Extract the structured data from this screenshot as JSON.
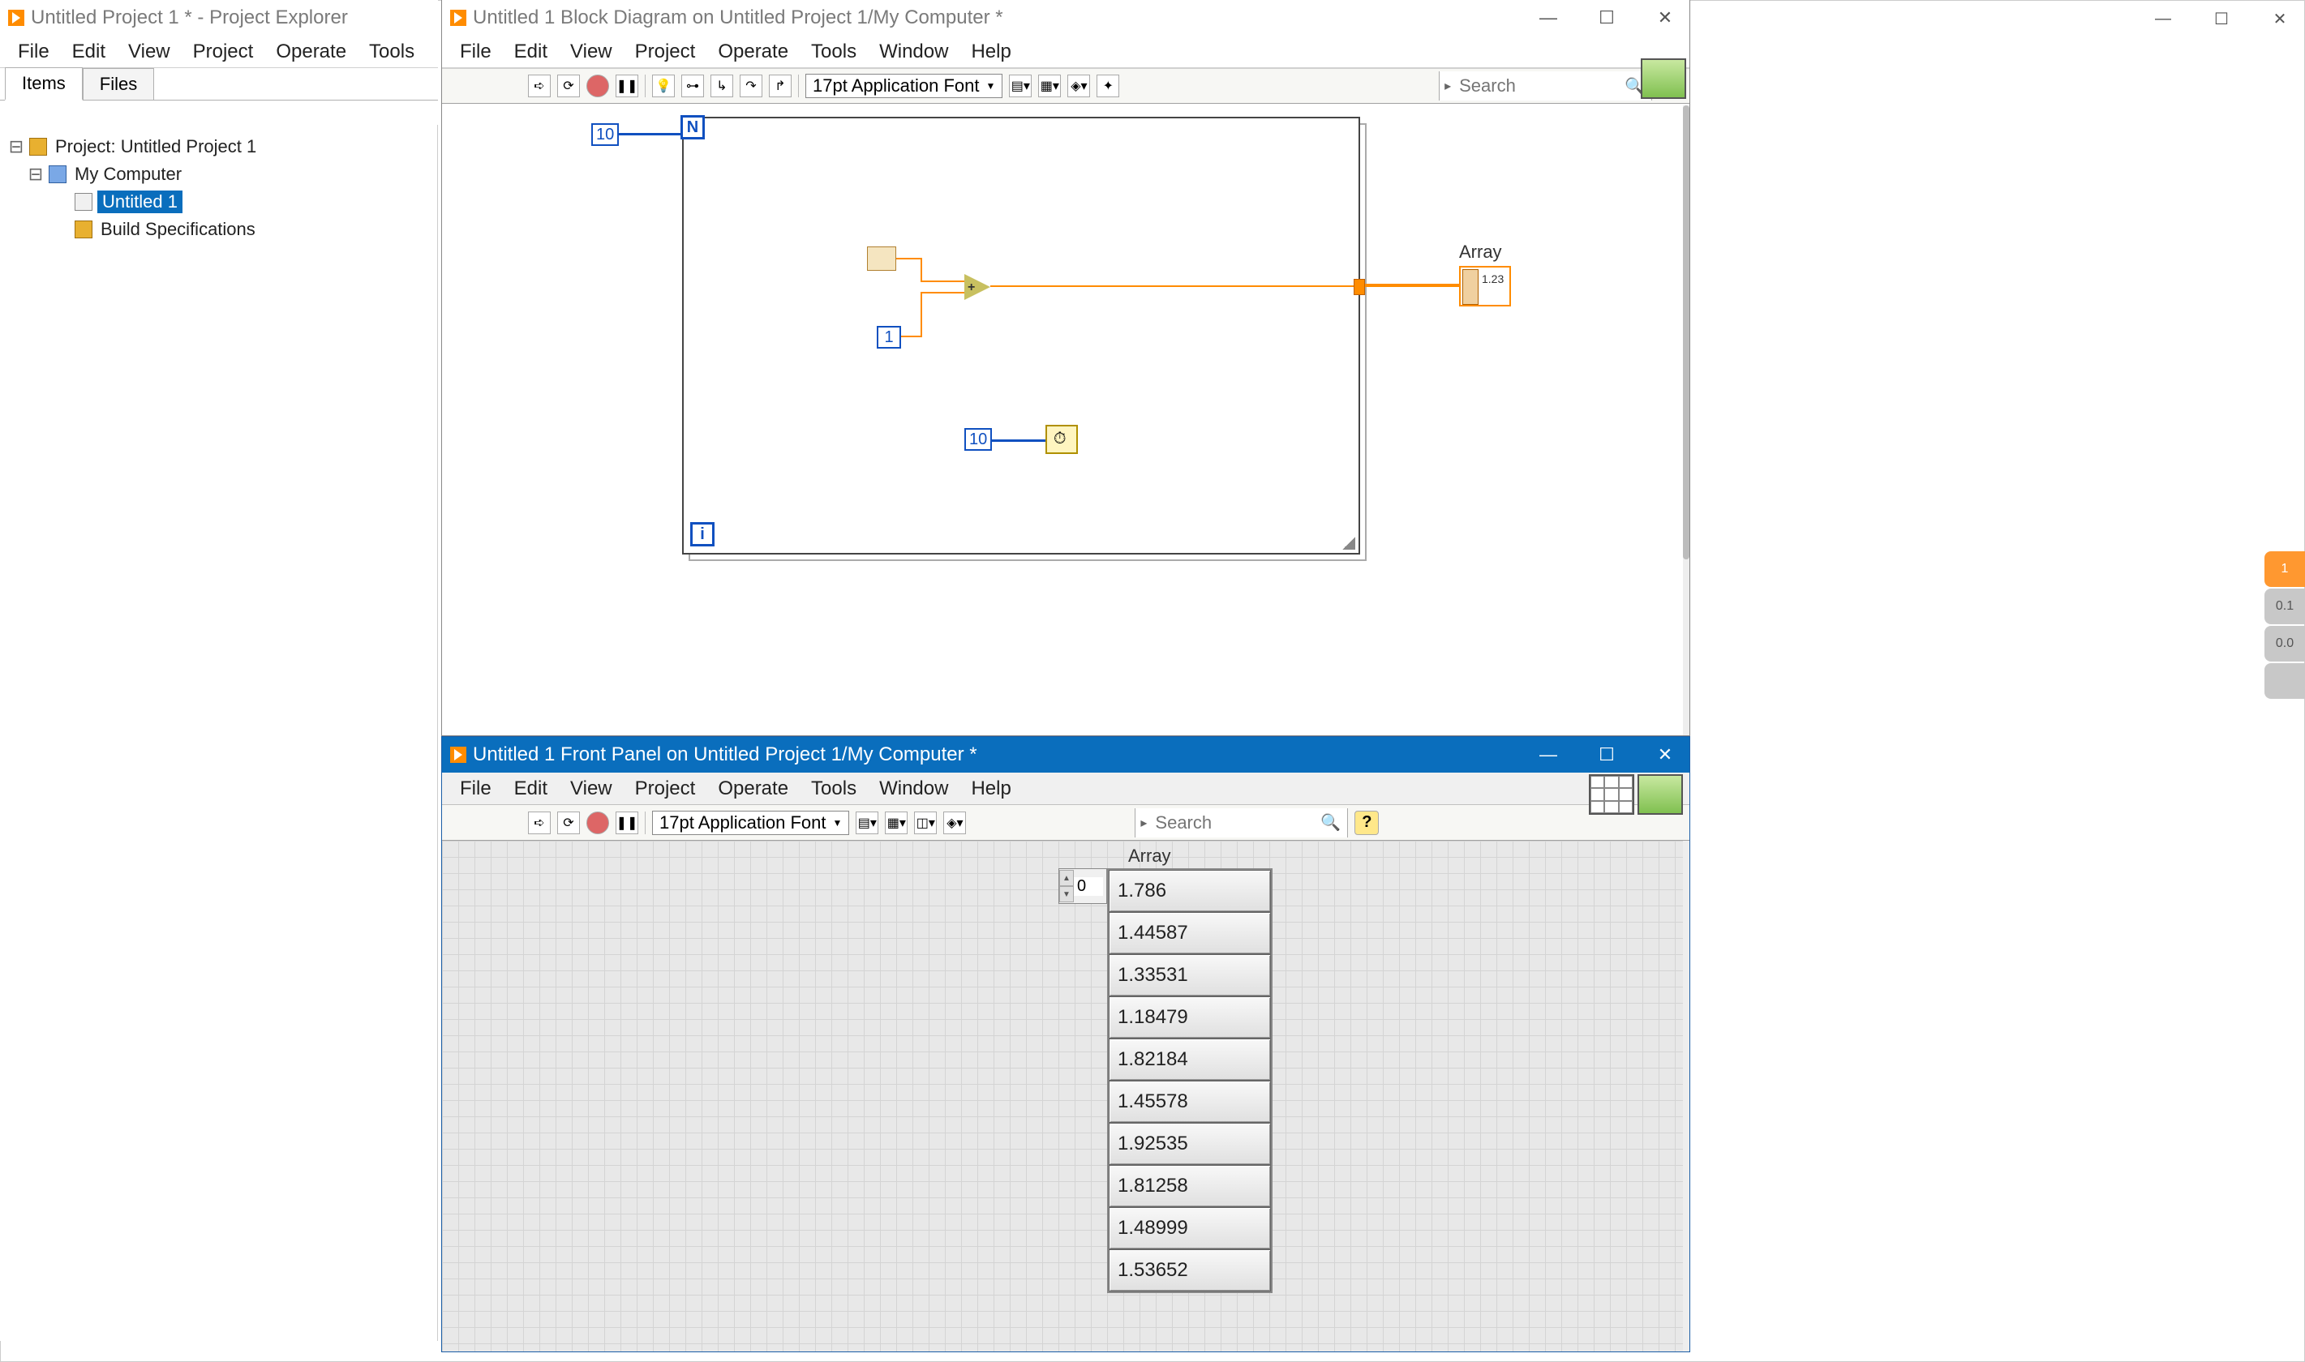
{
  "bg_window": {
    "min": "—",
    "max": "☐",
    "close": "✕"
  },
  "project_explorer": {
    "title": "Untitled Project 1 * - Project Explorer",
    "menu": [
      "File",
      "Edit",
      "View",
      "Project",
      "Operate",
      "Tools"
    ],
    "tabs": {
      "items": "Items",
      "files": "Files"
    },
    "tree": {
      "root": "Project: Untitled Project 1",
      "computer": "My Computer",
      "vi": "Untitled 1",
      "build": "Build Specifications"
    }
  },
  "block_diagram": {
    "title": "Untitled 1 Block Diagram on Untitled Project 1/My Computer *",
    "menu": [
      "File",
      "Edit",
      "View",
      "Project",
      "Operate",
      "Tools",
      "Window",
      "Help"
    ],
    "font_label": "17pt Application Font",
    "search_placeholder": "Search",
    "help_label": "?",
    "win": {
      "min": "—",
      "max": "☐",
      "close": "✕"
    },
    "constants": {
      "loop_count": "10",
      "timer_ms": "10",
      "add_const": "1"
    },
    "terminals": {
      "N": "N",
      "i": "i"
    },
    "array_label": "Array"
  },
  "front_panel": {
    "title": "Untitled 1 Front Panel on Untitled Project 1/My Computer *",
    "menu": [
      "File",
      "Edit",
      "View",
      "Project",
      "Operate",
      "Tools",
      "Window",
      "Help"
    ],
    "font_label": "17pt Application Font",
    "search_placeholder": "Search",
    "help_label": "?",
    "win": {
      "min": "—",
      "max": "☐",
      "close": "✕"
    },
    "array": {
      "label": "Array",
      "index": "0",
      "values": [
        "1.786",
        "1.44587",
        "1.33531",
        "1.18479",
        "1.82184",
        "1.45578",
        "1.92535",
        "1.81258",
        "1.48999",
        "1.53652"
      ]
    }
  },
  "ruler": {
    "b1": "1",
    "b2": "0.1",
    "b3": "0.0",
    "b4": ""
  }
}
